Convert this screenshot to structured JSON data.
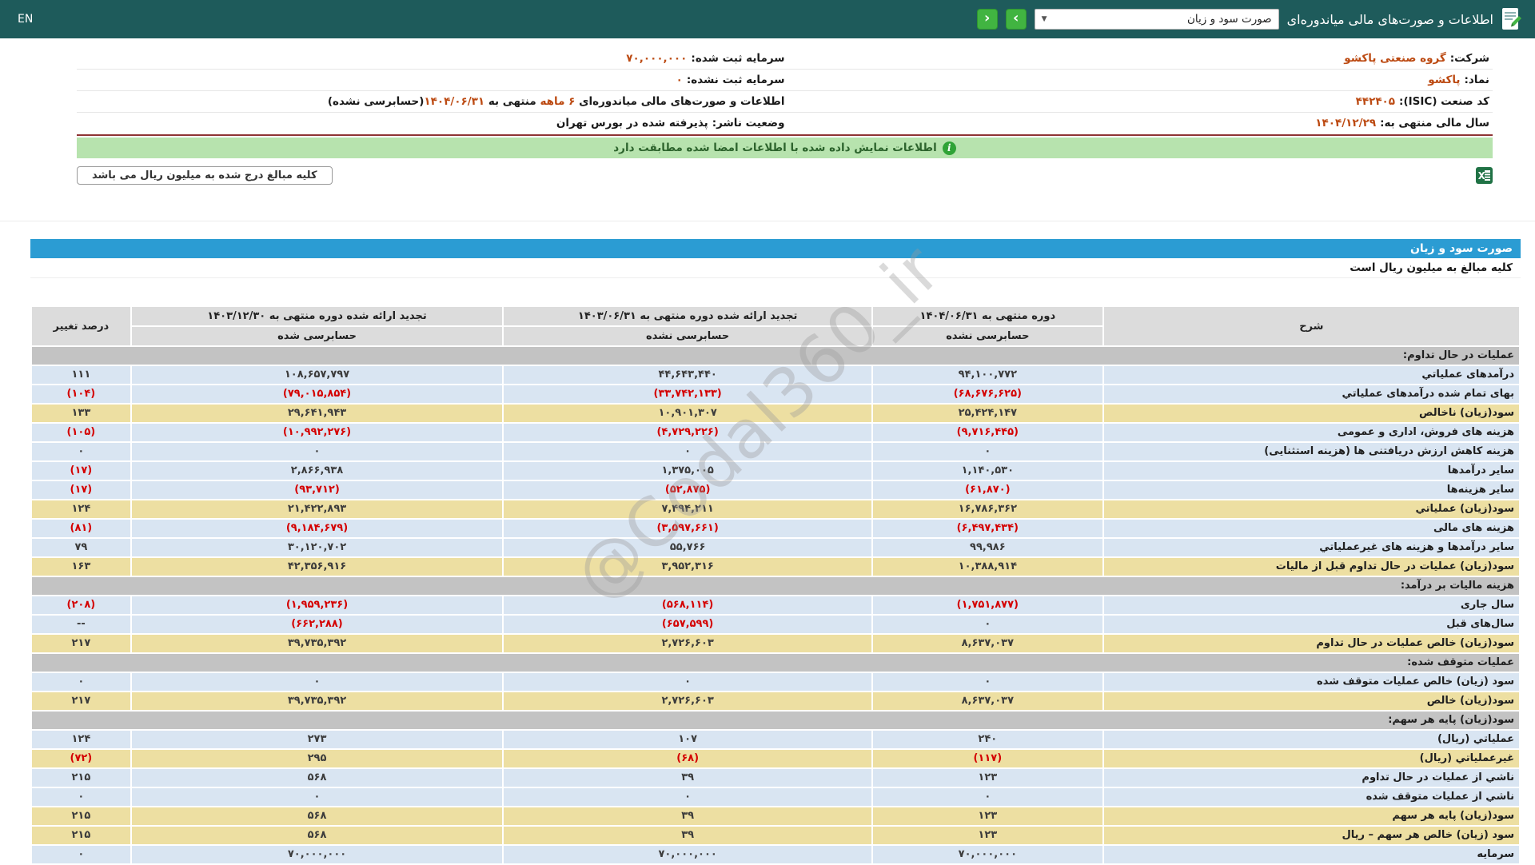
{
  "topbar": {
    "title": "اطلاعات و صورت‌های مالی میاندوره‌ای",
    "select_value": "صورت سود و زیان",
    "en": "EN"
  },
  "icons": {
    "info": "i",
    "prev": "‹",
    "next": "›",
    "caret": "▼"
  },
  "info": {
    "rows": [
      {
        "rl": "شرکت:",
        "rv": "گروه صنعتی پاکشو",
        "ll": "سرمایه ثبت شده:",
        "lv": "۷۰,۰۰۰,۰۰۰"
      },
      {
        "rl": "نماد:",
        "rv": "پاکشو",
        "ll": "سرمایه ثبت نشده:",
        "lv": "۰"
      },
      {
        "rl": "کد صنعت (ISIC):",
        "rv": "۴۴۲۴۰۵"
      },
      {
        "rl": "سال مالی منتهی به:",
        "rv": "۱۴۰۴/۱۲/۲۹",
        "ll": "وضعیت ناشر:",
        "lv": "پذیرفته شده در بورس تهران"
      }
    ],
    "period": {
      "prefix": "اطلاعات و صورت‌های مالی میاندوره‌ای ",
      "months": "۶ ماهه",
      "middle": " منتهی به ",
      "date": "۱۴۰۴/۰۶/۳۱",
      "suffix": "(حسابرسی نشده)"
    }
  },
  "banner": {
    "text": "اطلاعات نمایش داده شده با اطلاعات امضا شده مطابقت دارد"
  },
  "toolbar": {
    "units_tab": "کلیه مبالغ درج شده به میلیون ریال می باشد"
  },
  "statement": {
    "title": "صورت سود و زیان",
    "units_note": "کلیه مبالغ به میلیون ریال است",
    "headers": {
      "desc": "شرح",
      "col1_title": "دوره منتهی به ۱۴۰۴/۰۶/۳۱",
      "col1_sub": "حسابرسی نشده",
      "col2_title": "تجدید ارائه شده دوره منتهی به ۱۴۰۳/۰۶/۳۱",
      "col2_sub": "حسابرسی نشده",
      "col3_title": "تجدید ارائه شده دوره منتهی به ۱۴۰۳/۱۲/۳۰",
      "col3_sub": "حسابرسی شده",
      "pct": "درصد تغییر"
    },
    "rows": [
      {
        "type": "section",
        "label": "عملیات در حال تداوم:"
      },
      {
        "type": "blue",
        "label": "درآمدهای عملیاتي",
        "v": [
          "۹۴,۱۰۰,۷۷۲",
          "۴۴,۶۴۳,۴۴۰",
          "۱۰۸,۶۵۷,۷۹۷"
        ],
        "pct": "۱۱۱"
      },
      {
        "type": "blue",
        "label": "بهای تمام شده درآمدهای عملیاتي",
        "v": [
          "(۶۸,۶۷۶,۶۲۵)",
          "(۳۳,۷۴۲,۱۳۳)",
          "(۷۹,۰۱۵,۸۵۴)"
        ],
        "pct": "(۱۰۴)"
      },
      {
        "type": "yellow",
        "label": "سود(زیان) ناخالص",
        "v": [
          "۲۵,۴۲۴,۱۴۷",
          "۱۰,۹۰۱,۳۰۷",
          "۲۹,۶۴۱,۹۴۳"
        ],
        "pct": "۱۳۳"
      },
      {
        "type": "blue",
        "label": "هزینه های فروش، اداری و عمومی",
        "v": [
          "(۹,۷۱۶,۴۴۵)",
          "(۴,۷۲۹,۲۲۶)",
          "(۱۰,۹۹۲,۲۷۶)"
        ],
        "pct": "(۱۰۵)"
      },
      {
        "type": "blue",
        "label": "هزینه کاهش ارزش دریافتنی ها (هزینه استثنایی)",
        "v": [
          "۰",
          "۰",
          "۰"
        ],
        "pct": "۰"
      },
      {
        "type": "blue",
        "label": "سایر درآمدها",
        "v": [
          "۱,۱۴۰,۵۳۰",
          "۱,۳۷۵,۰۰۵",
          "۲,۸۶۶,۹۳۸"
        ],
        "pct": "(۱۷)"
      },
      {
        "type": "blue",
        "label": "سایر هزینه‌ها",
        "v": [
          "(۶۱,۸۷۰)",
          "(۵۲,۸۷۵)",
          "(۹۳,۷۱۲)"
        ],
        "pct": "(۱۷)"
      },
      {
        "type": "yellow",
        "label": "سود(زیان) عملیاتي",
        "v": [
          "۱۶,۷۸۶,۳۶۲",
          "۷,۴۹۴,۲۱۱",
          "۲۱,۴۲۲,۸۹۳"
        ],
        "pct": "۱۲۴"
      },
      {
        "type": "blue",
        "label": "هزینه های مالی",
        "v": [
          "(۶,۴۹۷,۴۳۴)",
          "(۳,۵۹۷,۶۶۱)",
          "(۹,۱۸۴,۶۷۹)"
        ],
        "pct": "(۸۱)"
      },
      {
        "type": "blue",
        "label": "سایر درآمدها و هزینه های غیرعملیاتي",
        "v": [
          "۹۹,۹۸۶",
          "۵۵,۷۶۶",
          "۳۰,۱۲۰,۷۰۲"
        ],
        "pct": "۷۹"
      },
      {
        "type": "yellow",
        "label": "سود(زیان) عملیات در حال تداوم قبل از مالیات",
        "v": [
          "۱۰,۳۸۸,۹۱۴",
          "۳,۹۵۲,۳۱۶",
          "۴۲,۳۵۶,۹۱۶"
        ],
        "pct": "۱۶۳"
      },
      {
        "type": "section",
        "label": "هزینه مالیات بر درآمد:"
      },
      {
        "type": "blue",
        "label": "سال جاری",
        "v": [
          "(۱,۷۵۱,۸۷۷)",
          "(۵۶۸,۱۱۴)",
          "(۱,۹۵۹,۲۳۶)"
        ],
        "pct": "(۲۰۸)"
      },
      {
        "type": "blue",
        "label": "سال‌های قبل",
        "v": [
          "۰",
          "(۶۵۷,۵۹۹)",
          "(۶۶۲,۲۸۸)"
        ],
        "pct": "--"
      },
      {
        "type": "yellow",
        "label": "سود(زیان) خالص عملیات در حال تداوم",
        "v": [
          "۸,۶۳۷,۰۳۷",
          "۲,۷۲۶,۶۰۳",
          "۳۹,۷۳۵,۳۹۲"
        ],
        "pct": "۲۱۷"
      },
      {
        "type": "section",
        "label": "عملیات متوقف شده:"
      },
      {
        "type": "blue",
        "label": "سود (زیان) خالص عملیات متوقف شده",
        "v": [
          "۰",
          "۰",
          "۰"
        ],
        "pct": "۰"
      },
      {
        "type": "yellow",
        "label": "سود(زیان) خالص",
        "v": [
          "۸,۶۳۷,۰۳۷",
          "۲,۷۲۶,۶۰۳",
          "۳۹,۷۳۵,۳۹۲"
        ],
        "pct": "۲۱۷"
      },
      {
        "type": "section",
        "label": "سود(زیان) پایه هر سهم:"
      },
      {
        "type": "blue",
        "label": "عملیاتي (ریال)",
        "v": [
          "۲۴۰",
          "۱۰۷",
          "۲۷۳"
        ],
        "pct": "۱۲۴"
      },
      {
        "type": "yellow",
        "label": "غیرعملیاتي (ریال)",
        "v": [
          "(۱۱۷)",
          "(۶۸)",
          "۲۹۵"
        ],
        "pct": "(۷۲)"
      },
      {
        "type": "blue",
        "label": "ناشي از عملیات در حال تداوم",
        "v": [
          "۱۲۳",
          "۳۹",
          "۵۶۸"
        ],
        "pct": "۲۱۵"
      },
      {
        "type": "blue",
        "label": "ناشي از عملیات متوقف شده",
        "v": [
          "۰",
          "۰",
          "۰"
        ],
        "pct": "۰"
      },
      {
        "type": "yellow",
        "label": "سود(زیان) پایه هر سهم",
        "v": [
          "۱۲۳",
          "۳۹",
          "۵۶۸"
        ],
        "pct": "۲۱۵"
      },
      {
        "type": "yellow",
        "label": "سود (زیان) خالص هر سهم – ریال",
        "v": [
          "۱۲۳",
          "۳۹",
          "۵۶۸"
        ],
        "pct": "۲۱۵"
      },
      {
        "type": "blue",
        "label": "سرمایه",
        "v": [
          "۷۰,۰۰۰,۰۰۰",
          "۷۰,۰۰۰,۰۰۰",
          "۷۰,۰۰۰,۰۰۰"
        ],
        "pct": "۰"
      }
    ]
  },
  "watermark": {
    "text": "@Codal360_ir"
  }
}
